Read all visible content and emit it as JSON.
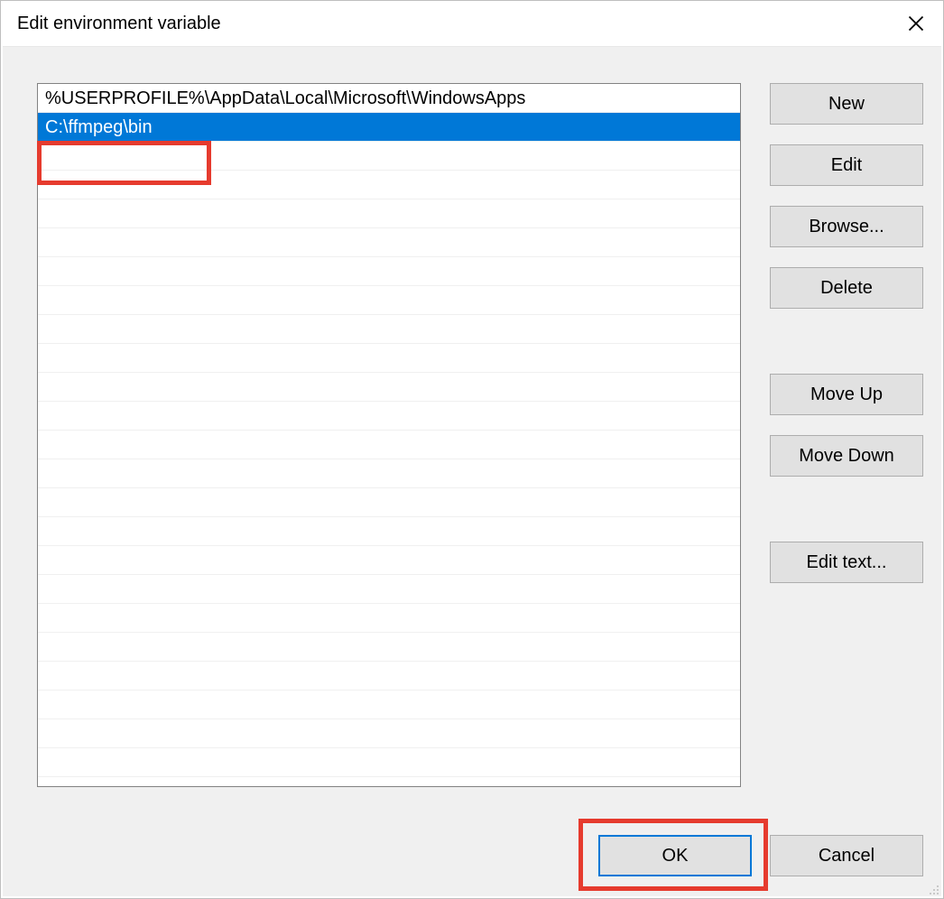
{
  "window": {
    "title": "Edit environment variable"
  },
  "list": {
    "rows": [
      {
        "value": "%USERPROFILE%\\AppData\\Local\\Microsoft\\WindowsApps",
        "selected": false
      },
      {
        "value": "C:\\ffmpeg\\bin",
        "selected": true
      }
    ],
    "empty_row_count": 22
  },
  "buttons": {
    "new": "New",
    "edit": "Edit",
    "browse": "Browse...",
    "delete": "Delete",
    "move_up": "Move Up",
    "move_down": "Move Down",
    "edit_text": "Edit text...",
    "ok": "OK",
    "cancel": "Cancel"
  },
  "annotations": {
    "highlight_row_index": 1,
    "highlight_ok_button": true
  }
}
